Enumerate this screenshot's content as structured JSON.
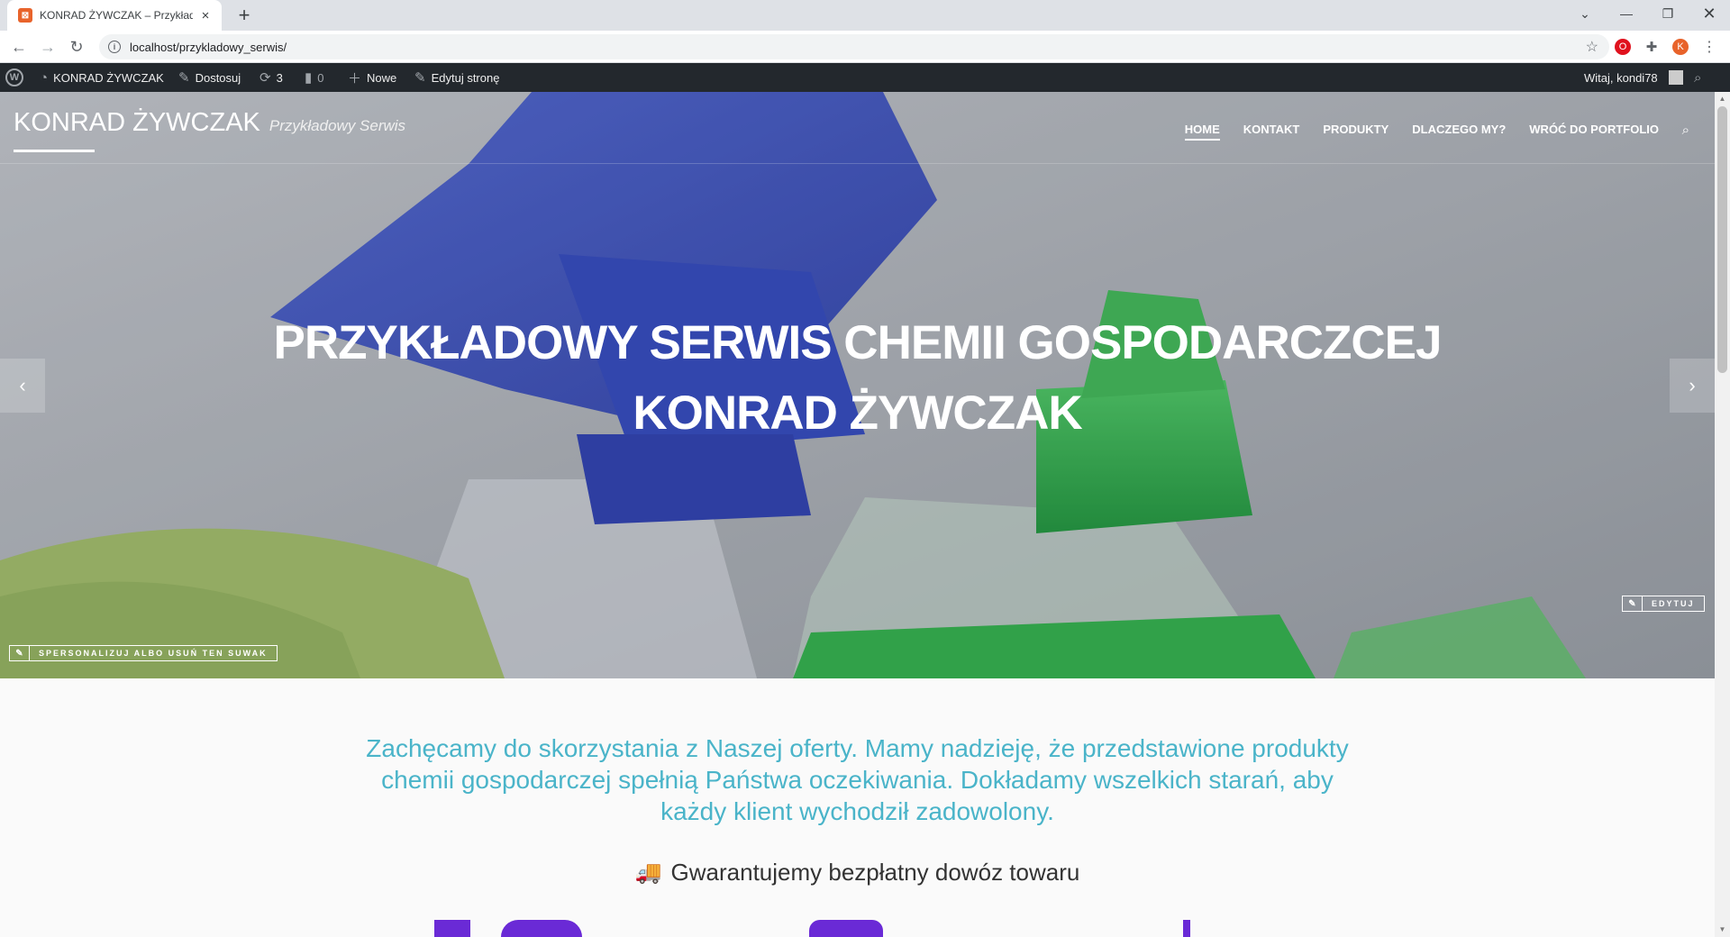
{
  "browser": {
    "tab_title": "KONRAD ŻYWCZAK – Przykładowy Serwis",
    "url": "localhost/przykladowy_serwis/",
    "new_tab": "+",
    "tab_close": "×",
    "profile_initial": "K"
  },
  "adminbar": {
    "site_name": "KONRAD ŻYWCZAK",
    "customize": "Dostosuj",
    "updates_count": "3",
    "comments_count": "0",
    "new_label": "Nowe",
    "edit_page": "Edytuj stronę",
    "greeting": "Witaj, kondi78"
  },
  "site": {
    "name": "KONRAD ŻYWCZAK",
    "tagline": "Przykładowy Serwis"
  },
  "nav": {
    "items": [
      "HOME",
      "KONTAKT",
      "PRODUKTY",
      "DLACZEGO MY?",
      "WRÓĆ DO PORTFOLIO"
    ],
    "active": "HOME"
  },
  "hero": {
    "title_line1": "PRZYKŁADOWY SERWIS CHEMII GOSPODARCZCEJ",
    "title_line2": "KONRAD ŻYWCZAK",
    "customize_slider": "SPERSONALIZUJ ALBO USUŃ TEN SUWAK",
    "edit": "EDYTUJ",
    "prev": "‹",
    "next": "›"
  },
  "content": {
    "lead": "Zachęcamy do skorzystania z Naszej oferty. Mamy nadzieję, że przedstawione produkty chemii gospodarczej spełnią Państwa oczekiwania. Dokładamy wszelkich starań, aby każdy klient wychodził zadowolony.",
    "delivery": "Gwarantujemy bezpłatny dowóz towaru"
  },
  "colors": {
    "accent_teal": "#4ab4c9",
    "adminbar_bg": "#23282d",
    "icon_purple": "#6a2ad6"
  }
}
